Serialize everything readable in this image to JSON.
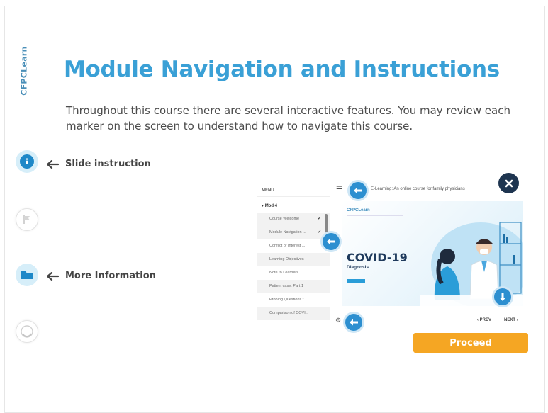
{
  "brand": {
    "vertical_logo": "CFPCLearn"
  },
  "page": {
    "title": "Module Navigation and Instructions",
    "intro": "Throughout this course there are several interactive features. You may review each marker on the screen to understand how to navigate this course."
  },
  "sidebar": [
    {
      "icon": "info-icon",
      "label": "Slide instruction",
      "active": true
    },
    {
      "icon": "flag-icon",
      "label": "",
      "active": false
    },
    {
      "icon": "folder-icon",
      "label": "More Information",
      "active": true
    },
    {
      "icon": "progress-icon",
      "label": "",
      "active": false
    }
  ],
  "mock": {
    "menu_header": "MENU",
    "module": "Mod 4",
    "menu_items": [
      {
        "label": "Course Welcome",
        "checked": true
      },
      {
        "label": "Module Navigation ...",
        "checked": true
      },
      {
        "label": "Conflict of Interest ...",
        "checked": false
      },
      {
        "label": "Learning Objectives",
        "checked": false
      },
      {
        "label": "Note to Learners",
        "checked": false
      },
      {
        "label": "Patient case: Part 1",
        "checked": false
      },
      {
        "label": "Probing Questions f...",
        "checked": false
      },
      {
        "label": "Comparison of COVI...",
        "checked": false
      }
    ],
    "course_title": "E-Learning: An online course for family physicians",
    "hero_brand": "CFPCLearn",
    "hero_title": "COVID-19",
    "hero_subtitle": "Diagnosis",
    "prev_label": "PREV",
    "next_label": "NEXT"
  },
  "actions": {
    "proceed_label": "Proceed"
  },
  "colors": {
    "title": "#3aa0d6",
    "accent": "#2d8fd0",
    "proceed": "#f5a623",
    "close": "#1e3550"
  }
}
